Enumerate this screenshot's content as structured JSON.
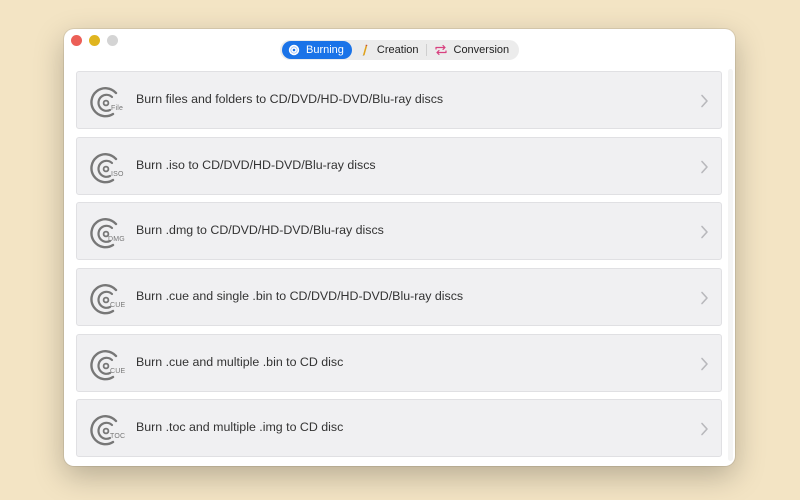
{
  "toolbar": {
    "tabs": [
      {
        "label": "Burning",
        "icon": "disc-icon",
        "active": true
      },
      {
        "label": "Creation",
        "icon": "pencil-icon",
        "active": false
      },
      {
        "label": "Conversion",
        "icon": "convert-icon",
        "active": false
      }
    ]
  },
  "items": [
    {
      "label": "Burn files and folders to CD/DVD/HD-DVD/Blu-ray discs",
      "tag": "File"
    },
    {
      "label": "Burn .iso to CD/DVD/HD-DVD/Blu-ray discs",
      "tag": "ISO"
    },
    {
      "label": "Burn .dmg to CD/DVD/HD-DVD/Blu-ray discs",
      "tag": "DMG"
    },
    {
      "label": "Burn .cue and single .bin to CD/DVD/HD-DVD/Blu-ray discs",
      "tag": "CUE"
    },
    {
      "label": "Burn .cue and multiple .bin to CD disc",
      "tag": "CUE"
    },
    {
      "label": "Burn .toc and multiple .img to CD disc",
      "tag": "TOC"
    }
  ],
  "colors": {
    "background": "#f3e4c4",
    "accent": "#1a73e8",
    "convert_icon": "#d8407f",
    "pencil_icon": "#e0a21a"
  }
}
